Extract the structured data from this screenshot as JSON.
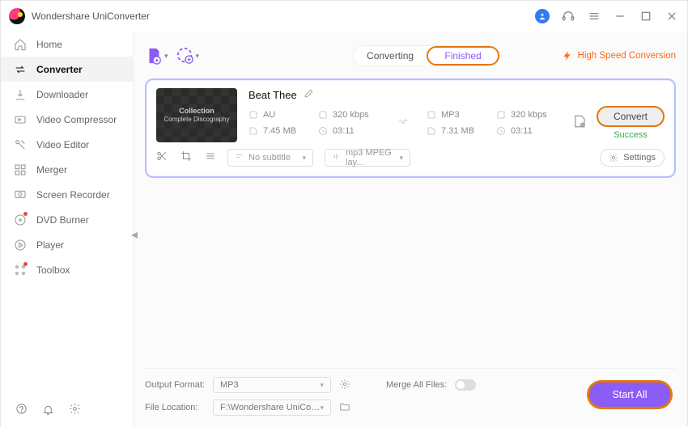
{
  "app": {
    "title": "Wondershare UniConverter"
  },
  "sidebar": {
    "items": [
      {
        "label": "Home"
      },
      {
        "label": "Converter"
      },
      {
        "label": "Downloader"
      },
      {
        "label": "Video Compressor"
      },
      {
        "label": "Video Editor"
      },
      {
        "label": "Merger"
      },
      {
        "label": "Screen Recorder"
      },
      {
        "label": "DVD Burner"
      },
      {
        "label": "Player"
      },
      {
        "label": "Toolbox"
      }
    ]
  },
  "toolbar": {
    "tabs": {
      "converting": "Converting",
      "finished": "Finished"
    },
    "hsc": "High Speed Conversion"
  },
  "item": {
    "title": "Beat Thee",
    "thumb": {
      "line1": "Collection",
      "line2": "Complete Discography"
    },
    "source": {
      "format": "AU",
      "bitrate": "320 kbps",
      "size": "7.45 MB",
      "duration": "03:11"
    },
    "target": {
      "format": "MP3",
      "bitrate": "320 kbps",
      "size": "7.31 MB",
      "duration": "03:11"
    },
    "convert_btn": "Convert",
    "status": "Success",
    "subtitle_select": "No subtitle",
    "codec_select": "mp3 MPEG lay...",
    "settings": "Settings"
  },
  "footer": {
    "output_format_label": "Output Format:",
    "output_format_value": "MP3",
    "file_location_label": "File Location:",
    "file_location_value": "F:\\Wondershare UniConverter",
    "merge_label": "Merge All Files:",
    "start_all": "Start All"
  }
}
